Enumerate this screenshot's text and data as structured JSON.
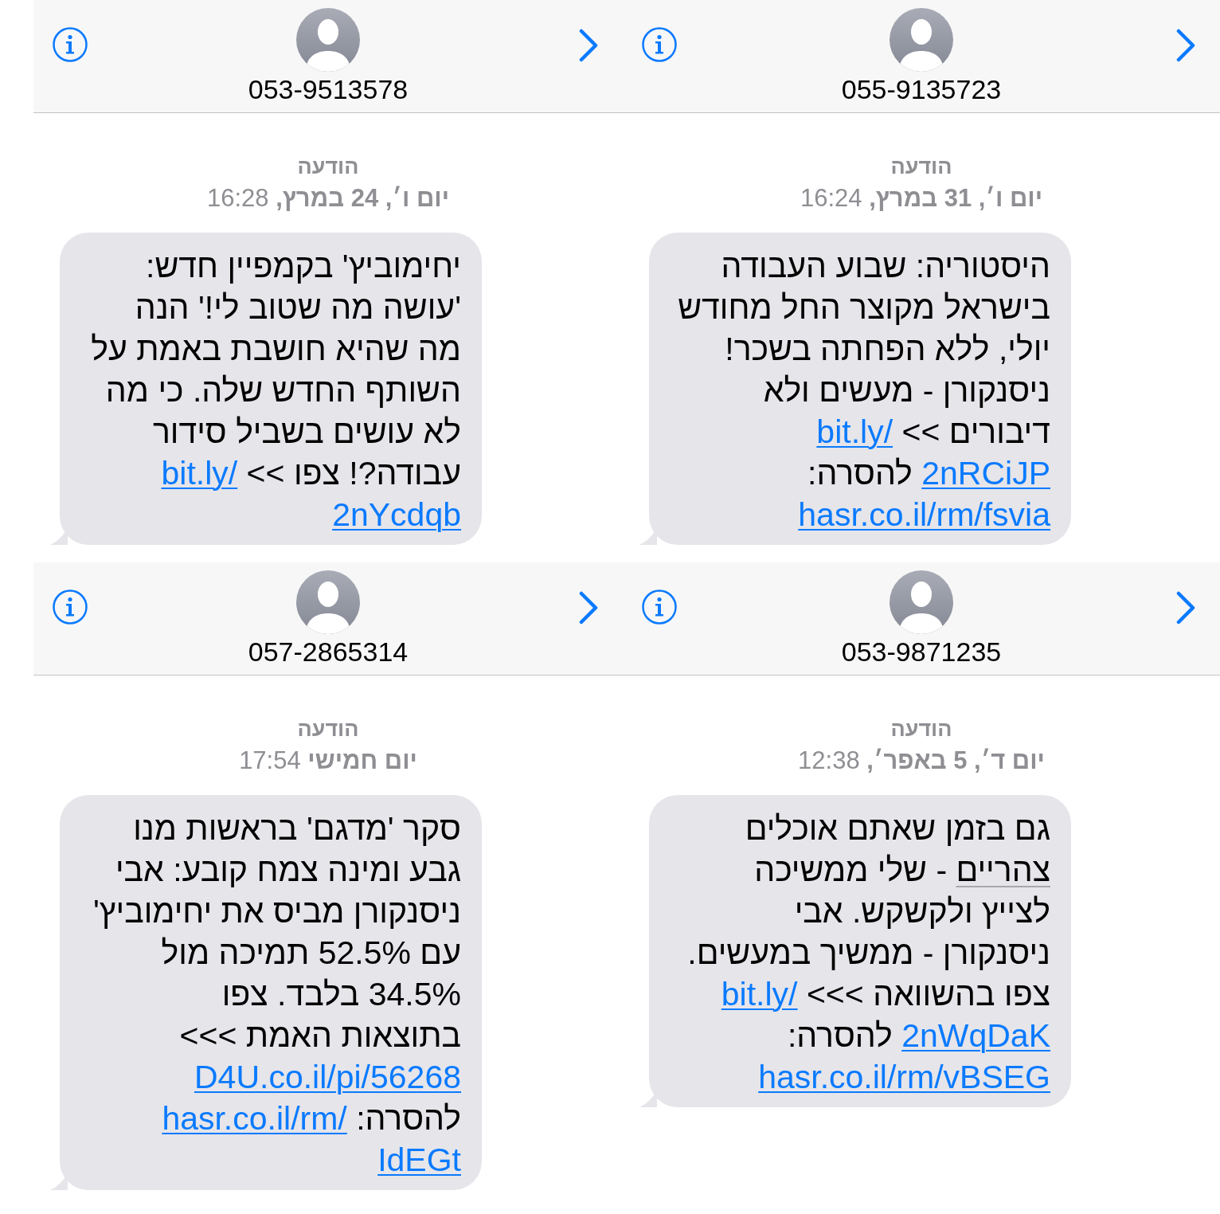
{
  "panels": [
    {
      "contact": {
        "number": "055-9135723"
      },
      "label": "הודעה",
      "timestamp": "**יום ו׳, 31 במרץ,** 16:24",
      "message": {
        "lines": [
          [
            {
              "kind": "text",
              "text": "היסטוריה: שבוע העבודה"
            }
          ],
          [
            {
              "kind": "text",
              "text": "בישראל מקוצר החל מחודש"
            }
          ],
          [
            {
              "kind": "text",
              "text": "יולי, ללא הפחתה בשכר!"
            }
          ],
          [
            {
              "kind": "text",
              "text": "ניסנקורן - מעשים ולא"
            }
          ],
          [
            {
              "kind": "text",
              "text": "דיבורים >> "
            },
            {
              "kind": "link",
              "text": "bit.ly/"
            }
          ],
          [
            {
              "kind": "link",
              "text": "2nRCiJP"
            },
            {
              "kind": "text",
              "text": " להסרה:"
            }
          ],
          [
            {
              "kind": "link",
              "text": "hasr.co.il/rm/fsvia"
            }
          ]
        ]
      }
    },
    {
      "contact": {
        "number": "053-9513578"
      },
      "label": "הודעה",
      "timestamp": "**יום ו׳, 24 במרץ,** 16:28",
      "message": {
        "lines": [
          [
            {
              "kind": "text",
              "text": "יחימוביץ' בקמפיין חדש:"
            }
          ],
          [
            {
              "kind": "text",
              "text": "'עושה מה שטוב לי!' הנה"
            }
          ],
          [
            {
              "kind": "text",
              "text": "מה שהיא חושבת באמת על"
            }
          ],
          [
            {
              "kind": "text",
              "text": "השותף החדש שלה. כי מה"
            }
          ],
          [
            {
              "kind": "text",
              "text": "לא עושים בשביל סידור"
            }
          ],
          [
            {
              "kind": "text",
              "text": "עבודה?! צפו >> "
            },
            {
              "kind": "link",
              "text": "bit.ly/"
            }
          ],
          [
            {
              "kind": "link",
              "text": "2nYcdqb"
            }
          ]
        ]
      }
    },
    {
      "contact": {
        "number": "053-9871235"
      },
      "label": "הודעה",
      "timestamp": "**יום ד׳, 5 באפר׳,** 12:38",
      "message": {
        "lines": [
          [
            {
              "kind": "text",
              "text": "גם בזמן שאתם אוכלים"
            }
          ],
          [
            {
              "kind": "detected",
              "text": "צהריים"
            },
            {
              "kind": "text",
              "text": " - שלי ממשיכה"
            }
          ],
          [
            {
              "kind": "text",
              "text": "לצייץ ולקשקש. אבי"
            }
          ],
          [
            {
              "kind": "text",
              "text": "ניסנקורן - ממשיך במעשים."
            }
          ],
          [
            {
              "kind": "text",
              "text": "צפו בהשוואה >>> "
            },
            {
              "kind": "link",
              "text": "bit.ly/"
            }
          ],
          [
            {
              "kind": "link",
              "text": "2nWqDaK"
            },
            {
              "kind": "text",
              "text": " להסרה:"
            }
          ],
          [
            {
              "kind": "link",
              "text": "hasr.co.il/rm/vBSEG"
            }
          ]
        ]
      }
    },
    {
      "contact": {
        "number": "057-2865314"
      },
      "label": "הודעה",
      "timestamp": "**יום חמישי** 17:54",
      "message": {
        "lines": [
          [
            {
              "kind": "text",
              "text": "סקר 'מדגם' בראשות מנו"
            }
          ],
          [
            {
              "kind": "text",
              "text": "גבע ומינה צמח קובע: אבי"
            }
          ],
          [
            {
              "kind": "text",
              "text": "ניסנקורן מביס את יחימוביץ'"
            }
          ],
          [
            {
              "kind": "text",
              "text": "עם 52.5% תמיכה מול"
            }
          ],
          [
            {
              "kind": "text",
              "text": "34.5% בלבד. צפו"
            }
          ],
          [
            {
              "kind": "text",
              "text": "בתוצאות האמת >>>"
            }
          ],
          [
            {
              "kind": "link",
              "text": "D4U.co.il/pi/56268"
            }
          ],
          [
            {
              "kind": "text",
              "text": "להסרה: "
            },
            {
              "kind": "link",
              "text": "hasr.co.il/rm/"
            }
          ],
          [
            {
              "kind": "link",
              "text": "IdEGt"
            }
          ]
        ]
      }
    }
  ]
}
